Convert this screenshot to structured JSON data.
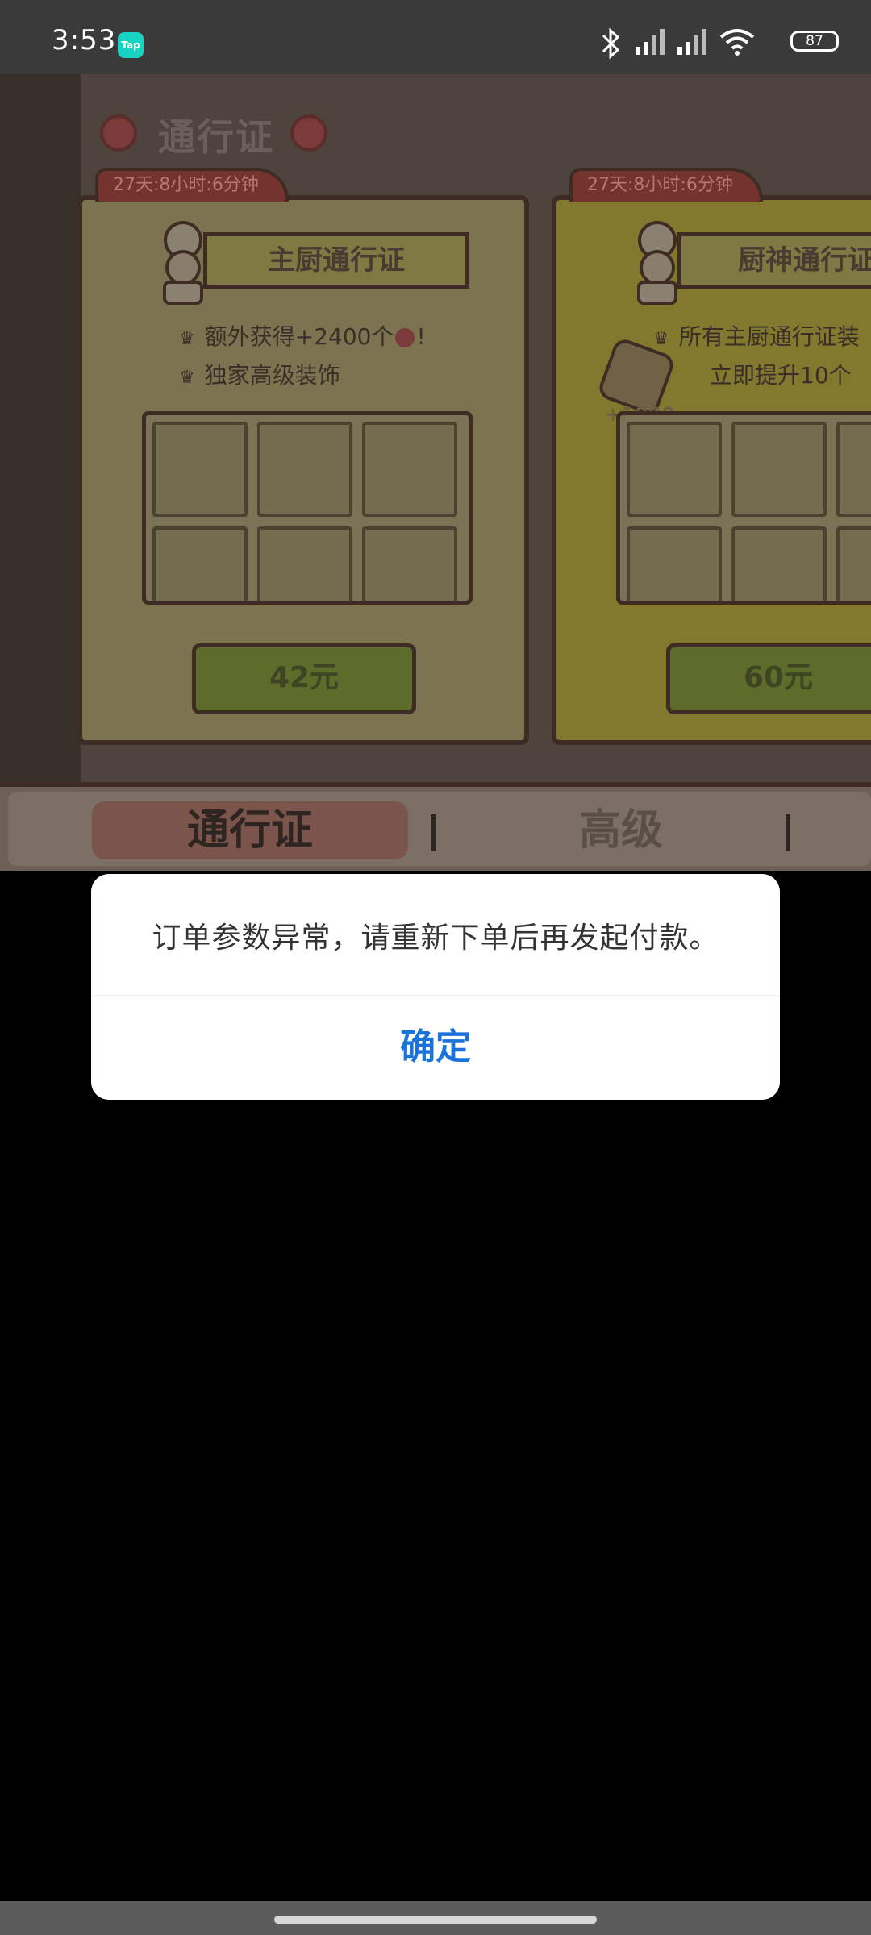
{
  "status_bar": {
    "time": "3:53",
    "app_badge": "Tap",
    "battery": "87",
    "icons": [
      "bluetooth-icon",
      "signal-icon",
      "signal-icon",
      "wifi-icon",
      "battery-icon"
    ]
  },
  "game": {
    "title": "通行证",
    "cards": [
      {
        "timer": "27天:8小时:6分钟",
        "banner": "主厨通行证",
        "perks": [
          "额外获得+2400个",
          "独家高级装饰"
        ],
        "perk_suffix": "!",
        "price": "42元"
      },
      {
        "timer": "27天:8小时:6分钟",
        "banner": "厨神通行证",
        "perks": [
          "所有主厨通行证装",
          "立即提升10个"
        ],
        "extra": "+1000",
        "price": "60元"
      }
    ],
    "tabs": [
      "通行证",
      "高级"
    ]
  },
  "dialog": {
    "message": "订单参数异常，请重新下单后再发起付款。",
    "confirm": "确定"
  },
  "colors": {
    "dialog_button": "#1a73d9",
    "status_bar": "#3a3a3a"
  }
}
